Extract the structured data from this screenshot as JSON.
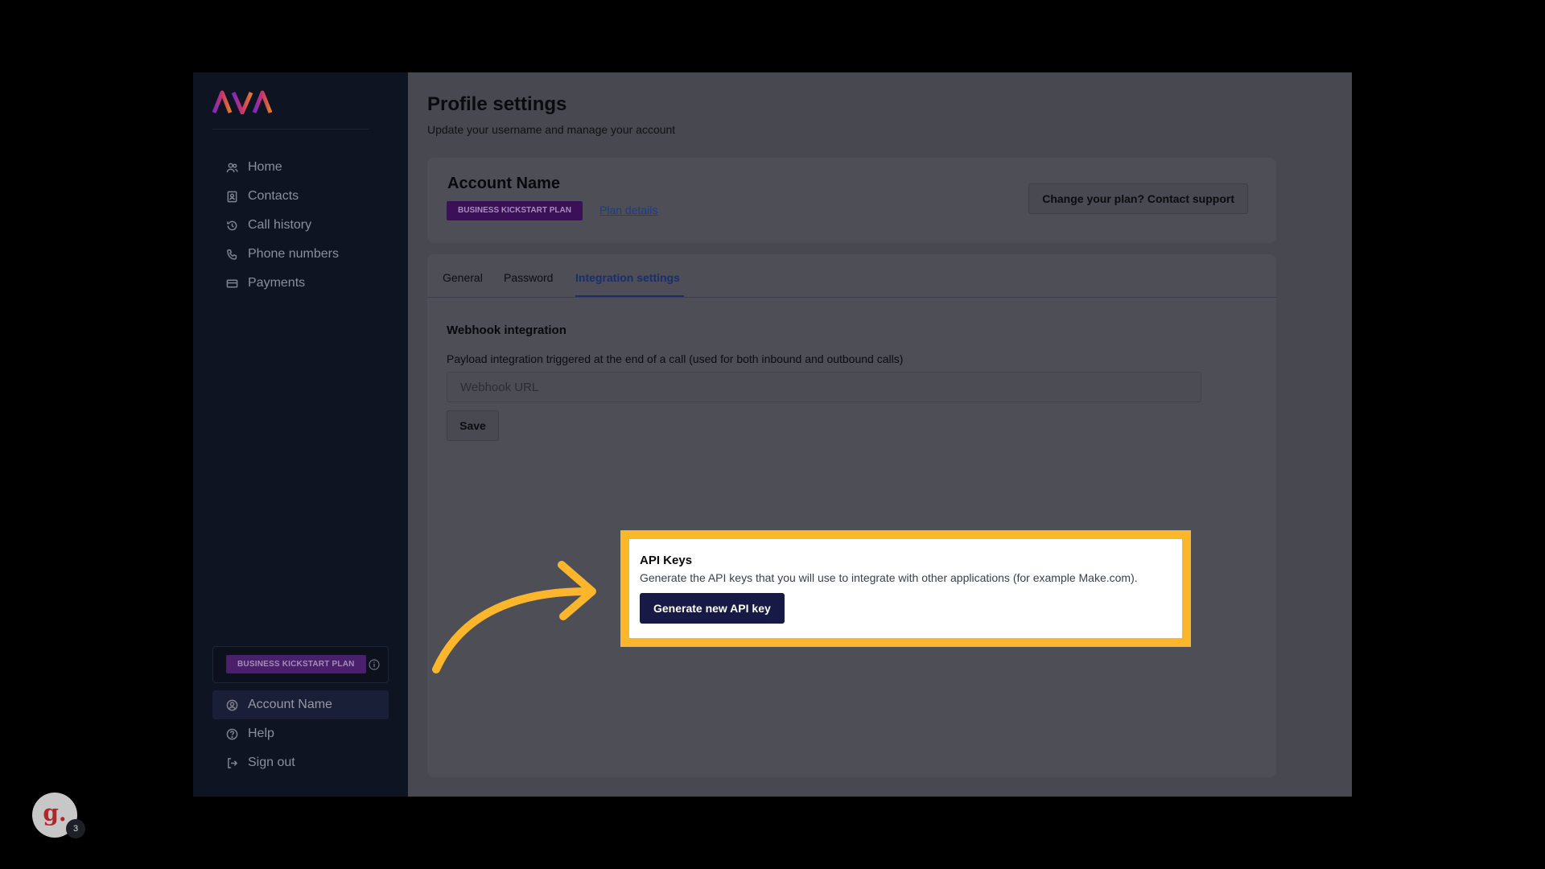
{
  "brand": {
    "name": "AVA"
  },
  "sidebar": {
    "items": [
      {
        "label": "Home",
        "icon": "users-icon"
      },
      {
        "label": "Contacts",
        "icon": "contacts-icon"
      },
      {
        "label": "Call history",
        "icon": "history-icon"
      },
      {
        "label": "Phone numbers",
        "icon": "phone-icon"
      },
      {
        "label": "Payments",
        "icon": "card-icon"
      }
    ],
    "plan_badge": "BUSINESS KICKSTART PLAN",
    "bottom_items": [
      {
        "label": "Account Name",
        "icon": "user-circle-icon",
        "active": true
      },
      {
        "label": "Help",
        "icon": "help-icon"
      },
      {
        "label": "Sign out",
        "icon": "sign-out-icon"
      }
    ]
  },
  "main": {
    "title": "Profile settings",
    "subtitle": "Update your username and manage your account",
    "account": {
      "name": "Account Name",
      "plan_badge": "BUSINESS KICKSTART PLAN",
      "plan_link": "Plan details",
      "contact_button": "Change your plan? Contact support"
    },
    "tabs": [
      {
        "label": "General"
      },
      {
        "label": "Password"
      },
      {
        "label": "Integration settings",
        "active": true
      }
    ],
    "webhook": {
      "title": "Webhook integration",
      "description": "Payload integration triggered at the end of a call (used for both inbound and outbound calls)",
      "placeholder": "Webhook URL",
      "save_label": "Save"
    },
    "api_keys": {
      "title": "API Keys",
      "description": "Generate the API keys that you will use to integrate with other applications (for example Make.com).",
      "button_label": "Generate new API key"
    }
  },
  "watermark": {
    "letter": "g.",
    "count": "3"
  },
  "colors": {
    "highlight": "#fcb62c",
    "primary_button": "#161a44",
    "plan_badge": "#4a1f6b"
  }
}
